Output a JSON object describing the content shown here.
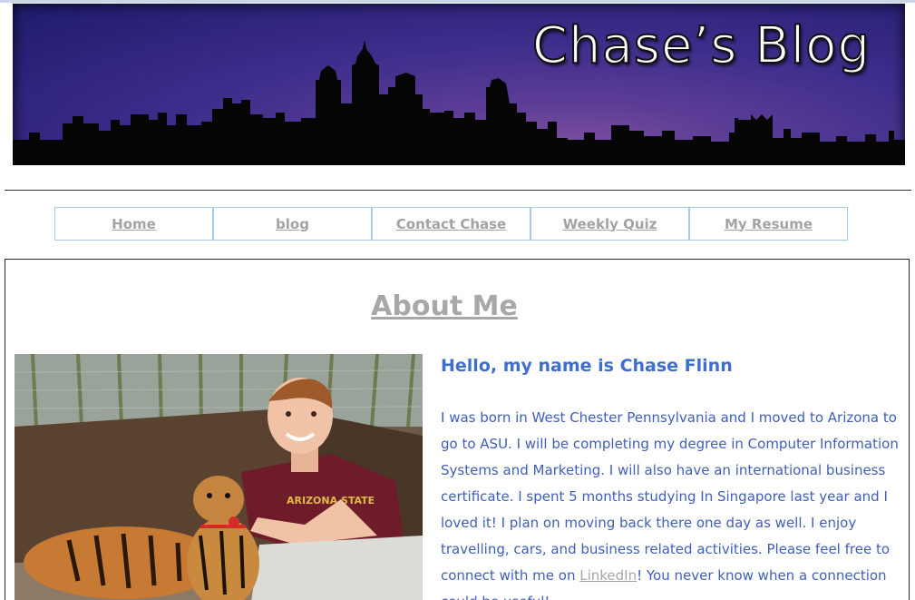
{
  "header": {
    "banner_title": "Chase’s Blog"
  },
  "nav": {
    "items": [
      {
        "label": "Home"
      },
      {
        "label": "blog"
      },
      {
        "label": "Contact Chase"
      },
      {
        "label": "Weekly Quiz"
      },
      {
        "label": "My Resume"
      }
    ]
  },
  "main": {
    "heading": "About Me",
    "greeting": "Hello, my name is Chase Flinn",
    "bio_before_link": "I was born in West Chester Pennsylvania and I moved to Arizona to go to ASU. I will be completing my degree in Computer Information Systems and Marketing. I will also have an international business certificate. I spent 5 months studying In Singapore last year and I loved it! I plan on moving back there one day as well. I enjoy travelling, cars, and business related activities. Please feel free to connect with me on ",
    "bio_link": "LinkedIn",
    "bio_after_link": "! You never know when a connection could be useful!"
  },
  "colors": {
    "nav_border": "#a8cce8",
    "nav_text": "#a3a3a3",
    "heading": "#a8a8a8",
    "greeting": "#3f6fce",
    "bio_text": "#3f5fb8",
    "banner_sky": "#3c2d8a"
  }
}
